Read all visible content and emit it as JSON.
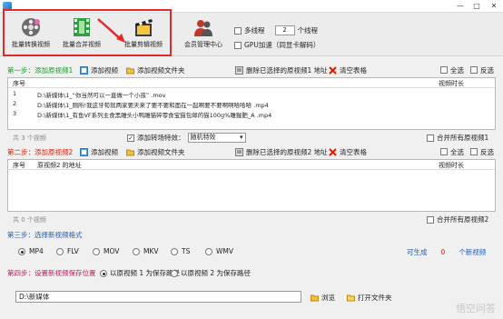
{
  "window": {
    "title": "",
    "minimize": "—",
    "maximize": "□",
    "close": "✕"
  },
  "toolbar": {
    "tools": [
      {
        "label": "批量转换视频"
      },
      {
        "label": "批量合并视频"
      },
      {
        "label": "批量剪辑视频"
      },
      {
        "label": "会员管理中心"
      }
    ],
    "multithread_label": "多线程",
    "thread_count": "2",
    "thread_unit": "个线程",
    "gpu_label": "GPU加速（同显卡解码）"
  },
  "step1": {
    "label": "第一步：添加原视频1",
    "add_video": "添加视频",
    "add_folder": "添加视频文件夹",
    "delete_selected": "删除已选择的原视频1 地址",
    "clear_table": "清空表格",
    "select_all": "全选",
    "invert": "反选",
    "columns": [
      "序号",
      "",
      "视频时长"
    ],
    "rows": [
      {
        "num": "1",
        "path": "D:\\新媒体\\1_“你当然可以一直做一个小孩” .mov"
      },
      {
        "num": "2",
        "path": "D:\\新媒体\\1_厕所!我这牙荀就两家要天来了要不要和面在一起啊要不要啊啊哈哈哈 .mp4"
      },
      {
        "num": "3",
        "path": "D:\\新媒体\\1_有鱼VF系列主食黑雕头小鸭雕猫碎零食宝猫包邮的猫100g%雕猩肥_A .mp4"
      }
    ],
    "count": "共 3 个视频",
    "transition_label": "添加转场特效：",
    "transition_value": "随机特效",
    "merge_all_label": "合并所有原视频1"
  },
  "step2": {
    "label": "第二步：添加原视频2",
    "add_video": "添加视频",
    "add_folder": "添加视频文件夹",
    "delete_selected": "删除已选择的原视频2 地址",
    "clear_table": "清空表格",
    "select_all": "全选",
    "invert": "反选",
    "columns": [
      "序号",
      "原视频2 的地址",
      "视频时长"
    ],
    "count": "共 0 个视频",
    "merge_all_label": "合并所有原视频2"
  },
  "step3": {
    "label": "第三步：选择新视频格式",
    "formats": [
      "MP4",
      "FLV",
      "MOV",
      "MKV",
      "TS",
      "WMV"
    ],
    "selected": "MP4",
    "generated_label": "可生成",
    "generated_count": "0",
    "generated_unit": "个新视频"
  },
  "step4": {
    "label": "第四步：设置新视频保存位置",
    "option1": "以原视频 1 为保存路径",
    "option2": "以原视频 2 为保存路径",
    "path": "D:\\新媒体",
    "browse": "浏览",
    "open_folder": "打开文件夹"
  },
  "watermark": "悟空问答",
  "colors": {
    "red_annotation": "#e22a2a",
    "step_red": "#d81e06",
    "step_green": "#1f9a2e"
  }
}
